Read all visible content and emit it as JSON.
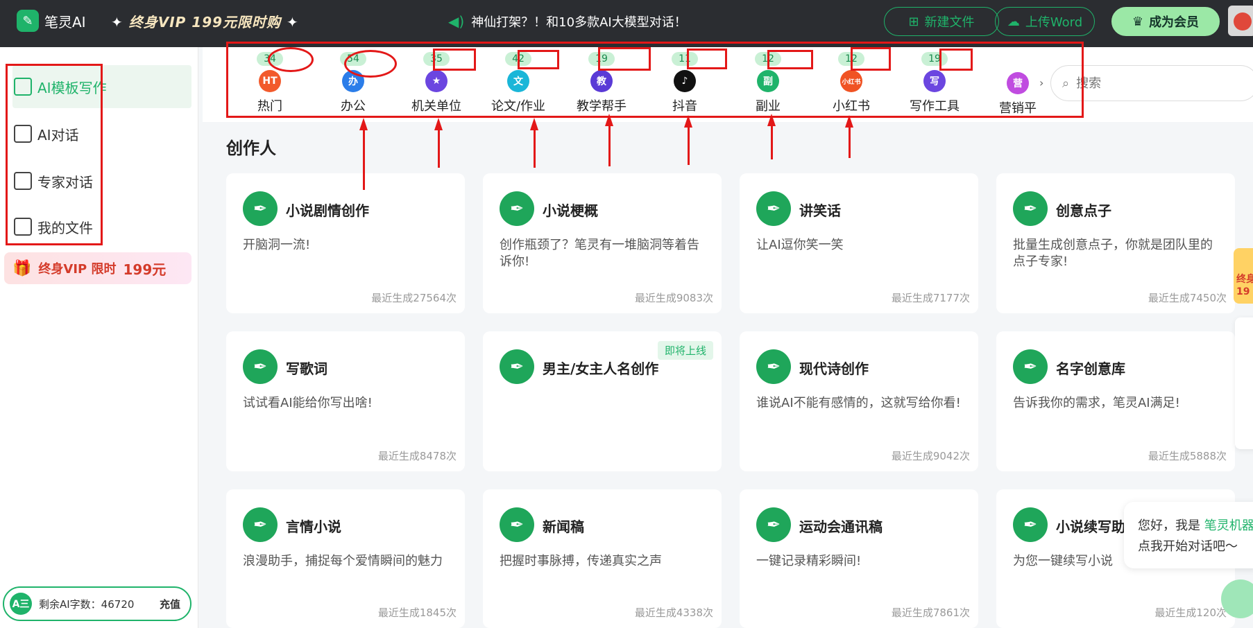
{
  "header": {
    "app_name": "笔灵AI",
    "vip_promo": "终身VIP 199元限时购",
    "announcement": "神仙打架？！和10多款AI大模型对话！",
    "new_file": "新建文件",
    "upload_word": "上传Word",
    "become_member": "成为会员"
  },
  "sidebar": {
    "items": [
      {
        "label": "AI模板写作",
        "icon": "template-icon"
      },
      {
        "label": "AI对话",
        "icon": "chat-icon"
      },
      {
        "label": "专家对话",
        "icon": "expert-icon"
      },
      {
        "label": "我的文件",
        "icon": "file-icon"
      }
    ],
    "vip_banner": {
      "text": "终身VIP 限时",
      "price": "199元"
    },
    "credits": {
      "icon_text": "A三",
      "label": "剩余AI字数：46720",
      "recharge": "充值"
    }
  },
  "categories": [
    {
      "label": "热门",
      "count": "34",
      "color": "#f25a2c",
      "icon_text": "HT"
    },
    {
      "label": "办公",
      "count": "54",
      "color": "#2b7de9",
      "icon_text": "办"
    },
    {
      "label": "机关单位",
      "count": "35",
      "color": "#6b46e0",
      "icon_text": "★"
    },
    {
      "label": "论文/作业",
      "count": "42",
      "color": "#1ab6d8",
      "icon_text": "文"
    },
    {
      "label": "教学帮手",
      "count": "19",
      "color": "#5a3ad6",
      "icon_text": "教"
    },
    {
      "label": "抖音",
      "count": "11",
      "color": "#111111",
      "icon_text": "♪"
    },
    {
      "label": "副业",
      "count": "12",
      "color": "#1fb36a",
      "icon_text": "副"
    },
    {
      "label": "小红书",
      "count": "12",
      "color": "#f05323",
      "icon_text": "小红书"
    },
    {
      "label": "写作工具",
      "count": "19",
      "color": "#6b46e0",
      "icon_text": "写"
    },
    {
      "label": "营销平",
      "count": "",
      "color": "#c04ce0",
      "icon_text": "营"
    }
  ],
  "search": {
    "placeholder": "搜索"
  },
  "section_title": "创作人",
  "cards": [
    {
      "title": "小说剧情创作",
      "desc": "开脑洞一流!",
      "footer": "最近生成27564次",
      "soon": ""
    },
    {
      "title": "小说梗概",
      "desc": "创作瓶颈了？笔灵有一堆脑洞等着告诉你!",
      "footer": "最近生成9083次",
      "soon": ""
    },
    {
      "title": "讲笑话",
      "desc": "让AI逗你笑一笑",
      "footer": "最近生成7177次",
      "soon": ""
    },
    {
      "title": "创意点子",
      "desc": "批量生成创意点子，你就是团队里的点子专家!",
      "footer": "最近生成7450次",
      "soon": ""
    },
    {
      "title": "写歌词",
      "desc": "试试看AI能给你写出啥!",
      "footer": "最近生成8478次",
      "soon": ""
    },
    {
      "title": "男主/女主人名创作",
      "desc": "",
      "footer": "",
      "soon": "即将上线"
    },
    {
      "title": "现代诗创作",
      "desc": "谁说AI不能有感情的，这就写给你看!",
      "footer": "最近生成9042次",
      "soon": ""
    },
    {
      "title": "名字创意库",
      "desc": "告诉我你的需求，笔灵AI满足!",
      "footer": "最近生成5888次",
      "soon": ""
    },
    {
      "title": "言情小说",
      "desc": "浪漫助手，捕捉每个爱情瞬间的魅力",
      "footer": "最近生成1845次",
      "soon": ""
    },
    {
      "title": "新闻稿",
      "desc": "把握时事脉搏，传递真实之声",
      "footer": "最近生成4338次",
      "soon": ""
    },
    {
      "title": "运动会通讯稿",
      "desc": "一键记录精彩瞬间!",
      "footer": "最近生成7861次",
      "soon": ""
    },
    {
      "title": "小说续写助",
      "desc": "为您一键续写小说",
      "footer": "最近生成120次",
      "soon": ""
    }
  ],
  "chat_bubble": {
    "line1_prefix": "您好，我是 ",
    "line1_highlight": "笔灵机器",
    "line2": "点我开始对话吧～"
  },
  "float_vip": "终身 19",
  "accent": "#1fb36a",
  "annotation_color": "#e31818"
}
